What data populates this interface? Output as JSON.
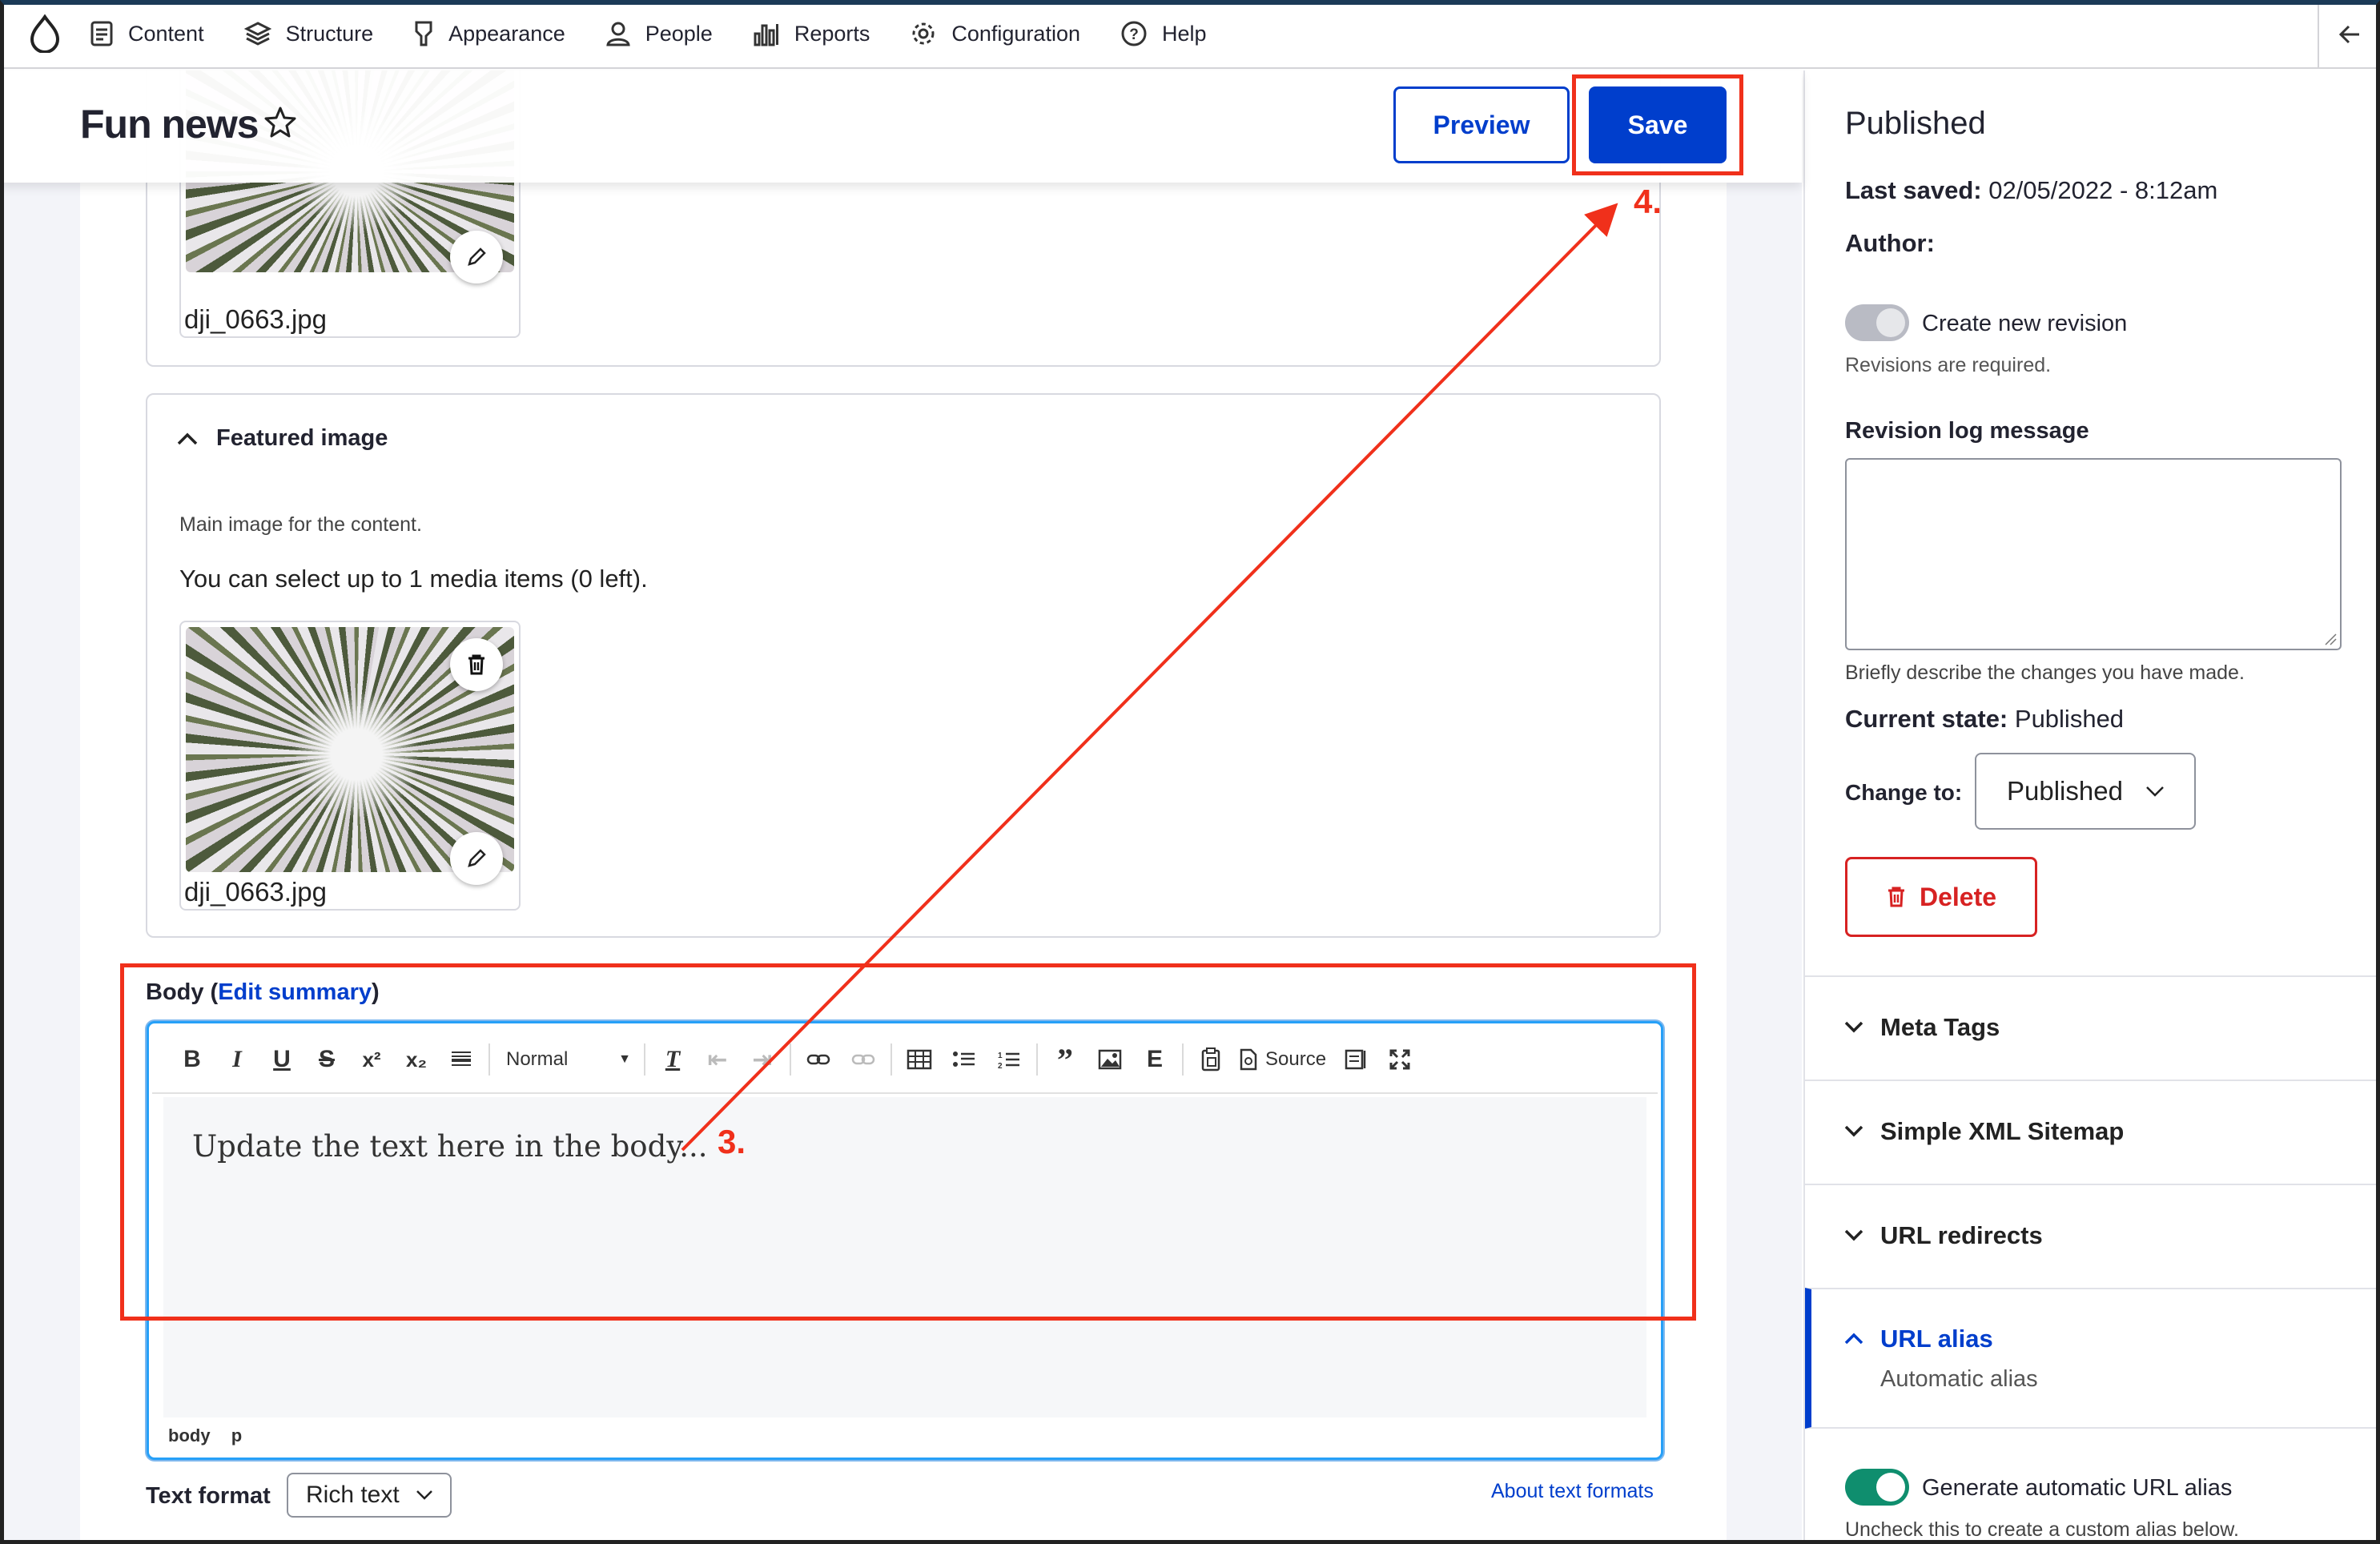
{
  "toolbar": {
    "items": [
      "Content",
      "Structure",
      "Appearance",
      "People",
      "Reports",
      "Configuration",
      "Help"
    ]
  },
  "header": {
    "title": "Fun news",
    "preview_label": "Preview",
    "save_label": "Save"
  },
  "media_top": {
    "filename": "dji_0663.jpg"
  },
  "featured_image": {
    "title": "Featured image",
    "description": "Main image for the content.",
    "limit_text": "You can select up to 1 media items (0 left).",
    "filename": "dji_0663.jpg"
  },
  "body_field": {
    "label_prefix": "Body (",
    "edit_summary": "Edit summary",
    "label_suffix": ")",
    "format_select": "Normal",
    "source_label": "Source",
    "content": "Update the text here in the body...",
    "path_body": "body",
    "path_p": "p",
    "text_format_label": "Text format",
    "text_format_value": "Rich text",
    "about_formats": "About text formats"
  },
  "sidebar": {
    "status": "Published",
    "last_saved_label": "Last saved:",
    "last_saved_value": "02/05/2022 - 8:12am",
    "author_label": "Author:",
    "new_revision_label": "Create new revision",
    "revisions_required": "Revisions are required.",
    "revision_log_label": "Revision log message",
    "revision_log_help": "Briefly describe the changes you have made.",
    "current_state_label": "Current state:",
    "current_state_value": "Published",
    "change_to_label": "Change to:",
    "change_to_value": "Published",
    "delete_label": "Delete",
    "sections": [
      "Meta Tags",
      "Simple XML Sitemap",
      "URL redirects"
    ],
    "url_alias": {
      "title": "URL alias",
      "summary": "Automatic alias"
    },
    "auto_alias_label": "Generate automatic URL alias",
    "auto_alias_help": "Uncheck this to create a custom alias below."
  },
  "annotations": {
    "step3": "3.",
    "step4": "4."
  },
  "colors": {
    "accent": "#003ecc",
    "annotation": "#f0301b",
    "danger": "#d72222",
    "toggle_on": "#0f8e6e"
  }
}
